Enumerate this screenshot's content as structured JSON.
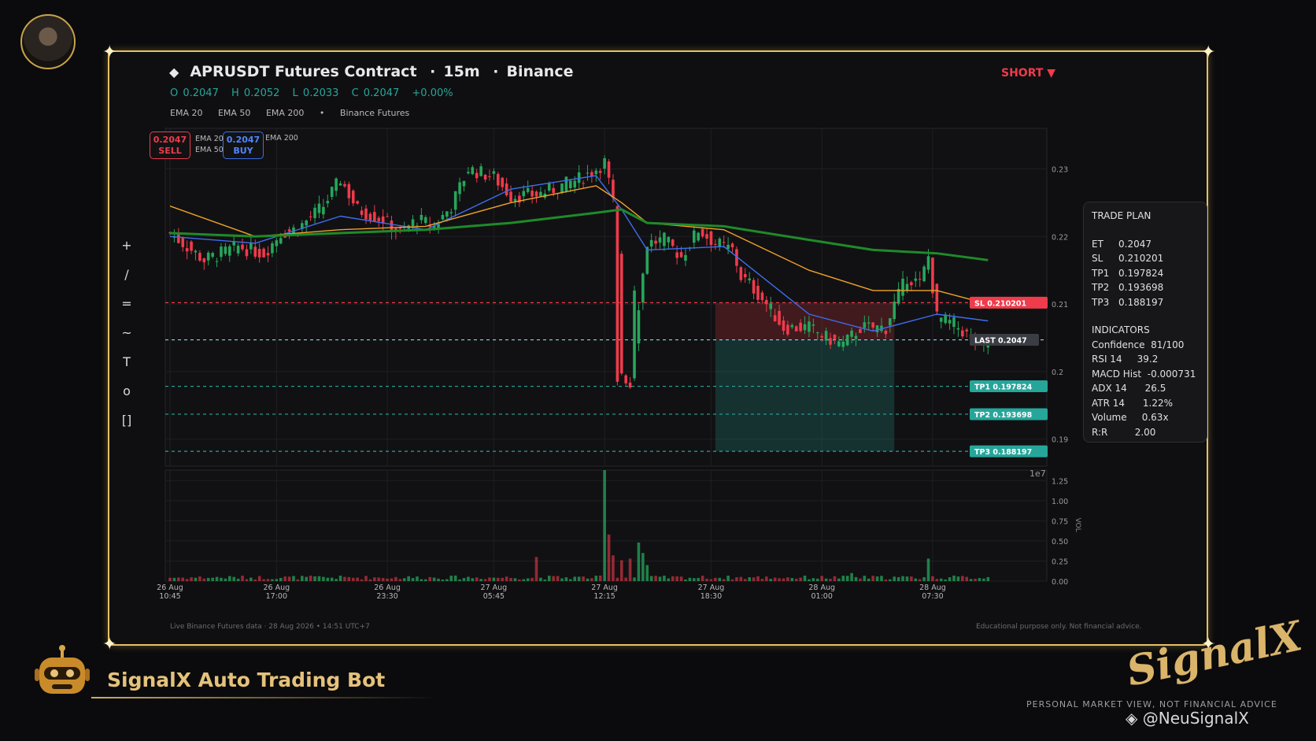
{
  "header": {
    "title": "APRUSDT Futures Contract",
    "interval": "15m",
    "exchange": "Binance",
    "ohlc": {
      "o": "O 0.2047",
      "h": "H 0.2052",
      "l": "L 0.2033",
      "c": "C 0.2047",
      "chg": "+0.00%"
    },
    "legend": [
      "EMA 20",
      "EMA 50",
      "EMA 200",
      "•",
      "Binance Futures"
    ],
    "side": "SHORT ▼"
  },
  "badges": {
    "sell_price": "0.2047",
    "sell_label": "SELL",
    "buy_price": "0.2047",
    "buy_label": "BUY",
    "mini_legend": [
      "EMA 20",
      "EMA 50"
    ],
    "mini_legend2": "EMA 200"
  },
  "toolbar": [
    "+",
    "/",
    "=",
    "~",
    "T",
    "o",
    "[]"
  ],
  "trade_plan": {
    "title": "TRADE PLAN",
    "levels": [
      {
        "k": "ET",
        "v": "0.2047"
      },
      {
        "k": "SL",
        "v": "0.210201"
      },
      {
        "k": "TP1",
        "v": "0.197824"
      },
      {
        "k": "TP2",
        "v": "0.193698"
      },
      {
        "k": "TP3",
        "v": "0.188197"
      }
    ],
    "indicators_title": "INDICATORS",
    "indicators": [
      {
        "k": "Confidence",
        "v": "81/100"
      },
      {
        "k": "RSI 14",
        "v": "39.2"
      },
      {
        "k": "MACD Hist",
        "v": "-0.000731"
      },
      {
        "k": "ADX 14",
        "v": "26.5"
      },
      {
        "k": "ATR 14",
        "v": "1.22%"
      },
      {
        "k": "Volume",
        "v": "0.63x"
      },
      {
        "k": "R:R",
        "v": "2.00"
      }
    ]
  },
  "chart_data": {
    "type": "candlestick",
    "price_axis": {
      "ticks": [
        "0.23",
        "0.22",
        "0.21",
        "0.2",
        "0.19"
      ],
      "range": [
        0.186,
        0.236
      ],
      "offset_label": "1e7"
    },
    "volume_axis": {
      "ticks": [
        "1.25",
        "1.00",
        "0.75",
        "0.50",
        "0.25",
        "0.00"
      ],
      "range": [
        0,
        1.38
      ],
      "label": "VOL"
    },
    "time_ticks": [
      {
        "date": "26 Aug",
        "time": "10:45",
        "i": 0
      },
      {
        "date": "26 Aug",
        "time": "17:00",
        "i": 25
      },
      {
        "date": "26 Aug",
        "time": "23:30",
        "i": 51
      },
      {
        "date": "27 Aug",
        "time": "05:45",
        "i": 76
      },
      {
        "date": "27 Aug",
        "time": "12:15",
        "i": 102
      },
      {
        "date": "27 Aug",
        "time": "18:30",
        "i": 127
      },
      {
        "date": "28 Aug",
        "time": "01:00",
        "i": 153
      },
      {
        "date": "28 Aug",
        "time": "07:30",
        "i": 179
      }
    ],
    "levels": [
      {
        "name": "SL",
        "value": 0.210201,
        "label": "SL  0.210201",
        "color": "#ef3b4b"
      },
      {
        "name": "LAST",
        "value": 0.2047,
        "label": "LAST  0.2047",
        "color": "#8fd3e8"
      },
      {
        "name": "TP1",
        "value": 0.197824,
        "label": "TP1  0.197824",
        "color": "#26a69a"
      },
      {
        "name": "TP2",
        "value": 0.193698,
        "label": "TP2  0.193698",
        "color": "#26a69a"
      },
      {
        "name": "TP3",
        "value": 0.188197,
        "label": "TP3  0.188197",
        "color": "#26a69a"
      }
    ],
    "anchors": [
      [
        0,
        0.2205
      ],
      [
        8,
        0.2165
      ],
      [
        16,
        0.2185
      ],
      [
        22,
        0.2175
      ],
      [
        26,
        0.2205
      ],
      [
        30,
        0.2212
      ],
      [
        36,
        0.2245
      ],
      [
        40,
        0.2285
      ],
      [
        44,
        0.224
      ],
      [
        50,
        0.2225
      ],
      [
        54,
        0.2205
      ],
      [
        58,
        0.2225
      ],
      [
        62,
        0.2215
      ],
      [
        66,
        0.2245
      ],
      [
        70,
        0.23
      ],
      [
        76,
        0.2288
      ],
      [
        80,
        0.226
      ],
      [
        86,
        0.2262
      ],
      [
        90,
        0.227
      ],
      [
        96,
        0.2285
      ],
      [
        100,
        0.23
      ],
      [
        102,
        0.231
      ],
      [
        104,
        0.225
      ],
      [
        105,
        0.218
      ],
      [
        106,
        0.2
      ],
      [
        108,
        0.198
      ],
      [
        110,
        0.21
      ],
      [
        112,
        0.219
      ],
      [
        116,
        0.2195
      ],
      [
        120,
        0.217
      ],
      [
        124,
        0.221
      ],
      [
        128,
        0.219
      ],
      [
        132,
        0.218
      ],
      [
        134,
        0.214
      ],
      [
        136,
        0.213
      ],
      [
        140,
        0.21
      ],
      [
        144,
        0.2065
      ],
      [
        150,
        0.2065
      ],
      [
        154,
        0.205
      ],
      [
        158,
        0.204
      ],
      [
        162,
        0.2065
      ],
      [
        168,
        0.2065
      ],
      [
        170,
        0.21
      ],
      [
        173,
        0.214
      ],
      [
        176,
        0.213
      ],
      [
        178,
        0.217
      ],
      [
        180,
        0.208
      ],
      [
        184,
        0.207
      ],
      [
        188,
        0.205
      ],
      [
        190,
        0.204
      ],
      [
        192,
        0.2047
      ]
    ],
    "ema": [
      {
        "name": "EMA 20",
        "color": "#3e6df0",
        "points": [
          [
            0,
            0.22
          ],
          [
            20,
            0.219
          ],
          [
            40,
            0.223
          ],
          [
            60,
            0.221
          ],
          [
            80,
            0.227
          ],
          [
            100,
            0.229
          ],
          [
            106,
            0.224
          ],
          [
            112,
            0.218
          ],
          [
            130,
            0.2185
          ],
          [
            150,
            0.2085
          ],
          [
            165,
            0.206
          ],
          [
            180,
            0.2085
          ],
          [
            192,
            0.2075
          ]
        ]
      },
      {
        "name": "EMA 50",
        "color": "#f0a227",
        "points": [
          [
            0,
            0.2245
          ],
          [
            20,
            0.22
          ],
          [
            40,
            0.221
          ],
          [
            60,
            0.2215
          ],
          [
            80,
            0.225
          ],
          [
            100,
            0.2275
          ],
          [
            106,
            0.225
          ],
          [
            112,
            0.222
          ],
          [
            130,
            0.221
          ],
          [
            150,
            0.215
          ],
          [
            165,
            0.212
          ],
          [
            180,
            0.212
          ],
          [
            192,
            0.21
          ]
        ]
      },
      {
        "name": "EMA 200",
        "color": "#1f8a2a",
        "points": [
          [
            0,
            0.2205
          ],
          [
            20,
            0.22
          ],
          [
            40,
            0.2205
          ],
          [
            60,
            0.221
          ],
          [
            80,
            0.222
          ],
          [
            100,
            0.2235
          ],
          [
            106,
            0.224
          ],
          [
            112,
            0.222
          ],
          [
            130,
            0.2215
          ],
          [
            150,
            0.2195
          ],
          [
            165,
            0.218
          ],
          [
            180,
            0.2175
          ],
          [
            192,
            0.2165
          ]
        ]
      }
    ],
    "zones": [
      {
        "from_i": 128,
        "to_i": 170,
        "top": 0.210201,
        "bottom": 0.2047,
        "kind": "loss"
      },
      {
        "from_i": 128,
        "to_i": 170,
        "top": 0.2047,
        "bottom": 0.188197,
        "kind": "profit"
      }
    ],
    "volume_spikes": [
      [
        86,
        0.3
      ],
      [
        102,
        1.38
      ],
      [
        103,
        0.58
      ],
      [
        104,
        0.32
      ],
      [
        106,
        0.26
      ],
      [
        108,
        0.28
      ],
      [
        110,
        0.48
      ],
      [
        111,
        0.35
      ],
      [
        112,
        0.2
      ],
      [
        178,
        0.28
      ],
      [
        160,
        0.1
      ]
    ]
  },
  "footer": {
    "left": "Live Binance Futures data  ·  28 Aug 2026 • 14:51 UTC+7",
    "right": "Educational purpose only. Not financial advice.",
    "bot_name": "SignalX Auto Trading Bot",
    "brand": "SignalX",
    "tagline": "PERSONAL MARKET VIEW, NOT FINANCIAL ADVICE",
    "handle": "@NeuSignalX"
  }
}
